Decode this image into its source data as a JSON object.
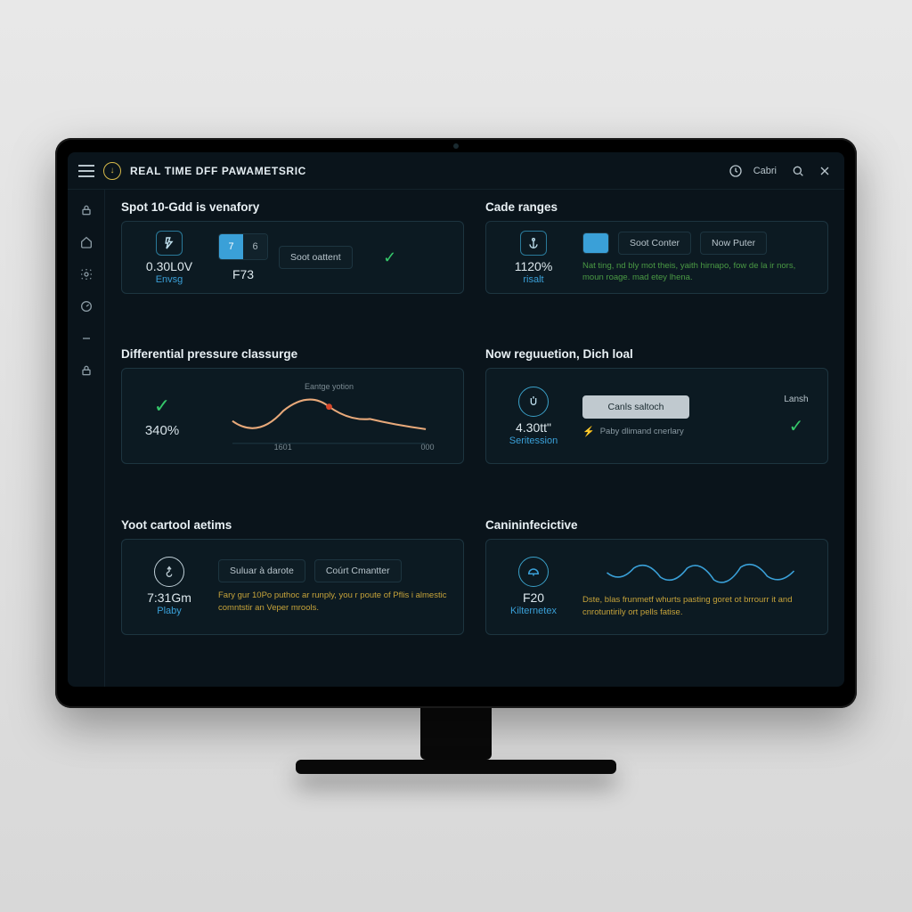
{
  "colors": {
    "accent": "#3aa0d8",
    "green": "#35c76a",
    "greenText": "#4a9a44",
    "yellow": "#c6a33a",
    "cyan": "#2a7a9a"
  },
  "header": {
    "title": "REAL TIME DFF PAWAMETSRIC",
    "logo_icon": "download-circle-icon",
    "menu_icon": "hamburger-icon",
    "right": {
      "clock_icon": "clock-icon",
      "label": "Cabri",
      "search_icon": "search-icon",
      "close_icon": "close-icon"
    }
  },
  "sidebar": {
    "items": [
      {
        "icon": "lock-icon"
      },
      {
        "icon": "home-icon"
      },
      {
        "icon": "gear-icon"
      },
      {
        "icon": "gauge-icon"
      },
      {
        "icon": "minus-icon"
      },
      {
        "icon": "padlock-icon"
      }
    ]
  },
  "cards": {
    "spot": {
      "title": "Spot 10-Gdd is venafory",
      "stat_icon": "energy-icon",
      "stat_value": "0.30L0V",
      "stat_label": "Envsg",
      "seg_a": "7",
      "seg_b": "6",
      "code": "F73",
      "btn": "Soot oattent",
      "check": true
    },
    "cade": {
      "title": "Cade ranges",
      "stat_icon": "anchor-icon",
      "stat_value": "1120%",
      "stat_label": "risalt",
      "seg_a": "",
      "btn_a": "Soot Conter",
      "btn_b": "Now Puter",
      "desc": "Nat ting, nd bly mot theis, yaith hirnapo, fow de la ir nors, moun roage. mad etey lhena."
    },
    "diff": {
      "title": "Differential pressure classurge",
      "value": "340%",
      "chart_data": {
        "type": "line",
        "title": "Eantge yotion",
        "x": [
          0,
          1,
          2,
          3,
          4,
          5,
          6
        ],
        "values": [
          0.42,
          0.22,
          0.5,
          0.46,
          0.44,
          0.34,
          0.3
        ],
        "marker_x": 3,
        "x_ticks": [
          "",
          "1601",
          "",
          "000"
        ],
        "xlabel": "",
        "ylabel": ""
      }
    },
    "now": {
      "title": "Now reguuetion, Dich loal",
      "stat_icon": "power-u-icon",
      "stat_value": "4.30tt\"",
      "stat_label": "Seritession",
      "btn": "Canls saltoch",
      "sub": "Paby dlimand cnerlary",
      "right_label": "Lansh",
      "right_check": true,
      "sub_icon": "bolt-icon"
    },
    "yoot": {
      "title": "Yoot cartool aetims",
      "stat_icon": "pointer-icon",
      "stat_value": "7:31Gm",
      "stat_label": "Plaby",
      "btn_a": "Suluar à darote",
      "btn_b": "Coúrt Cmantter",
      "desc": "Fary gur 10Po puthoc ar runply, you r poute of Pflis i almestic comntstir an Veper mrools."
    },
    "can": {
      "title": "Canininfecictive",
      "stat_icon": "dome-icon",
      "stat_value": "F20",
      "stat_label": "Kilternetex",
      "chart_data": {
        "type": "line",
        "x": [
          0,
          1,
          2,
          3,
          4,
          5,
          6,
          7,
          8,
          9,
          10
        ],
        "values": [
          0.5,
          0.3,
          0.6,
          0.35,
          0.55,
          0.4,
          0.7,
          0.3,
          0.5,
          0.38,
          0.55
        ]
      },
      "desc": "Dste, blas frunmetf whurts pasting goret ot brrourr it and cnrotuntirily ort pells fatise."
    }
  }
}
